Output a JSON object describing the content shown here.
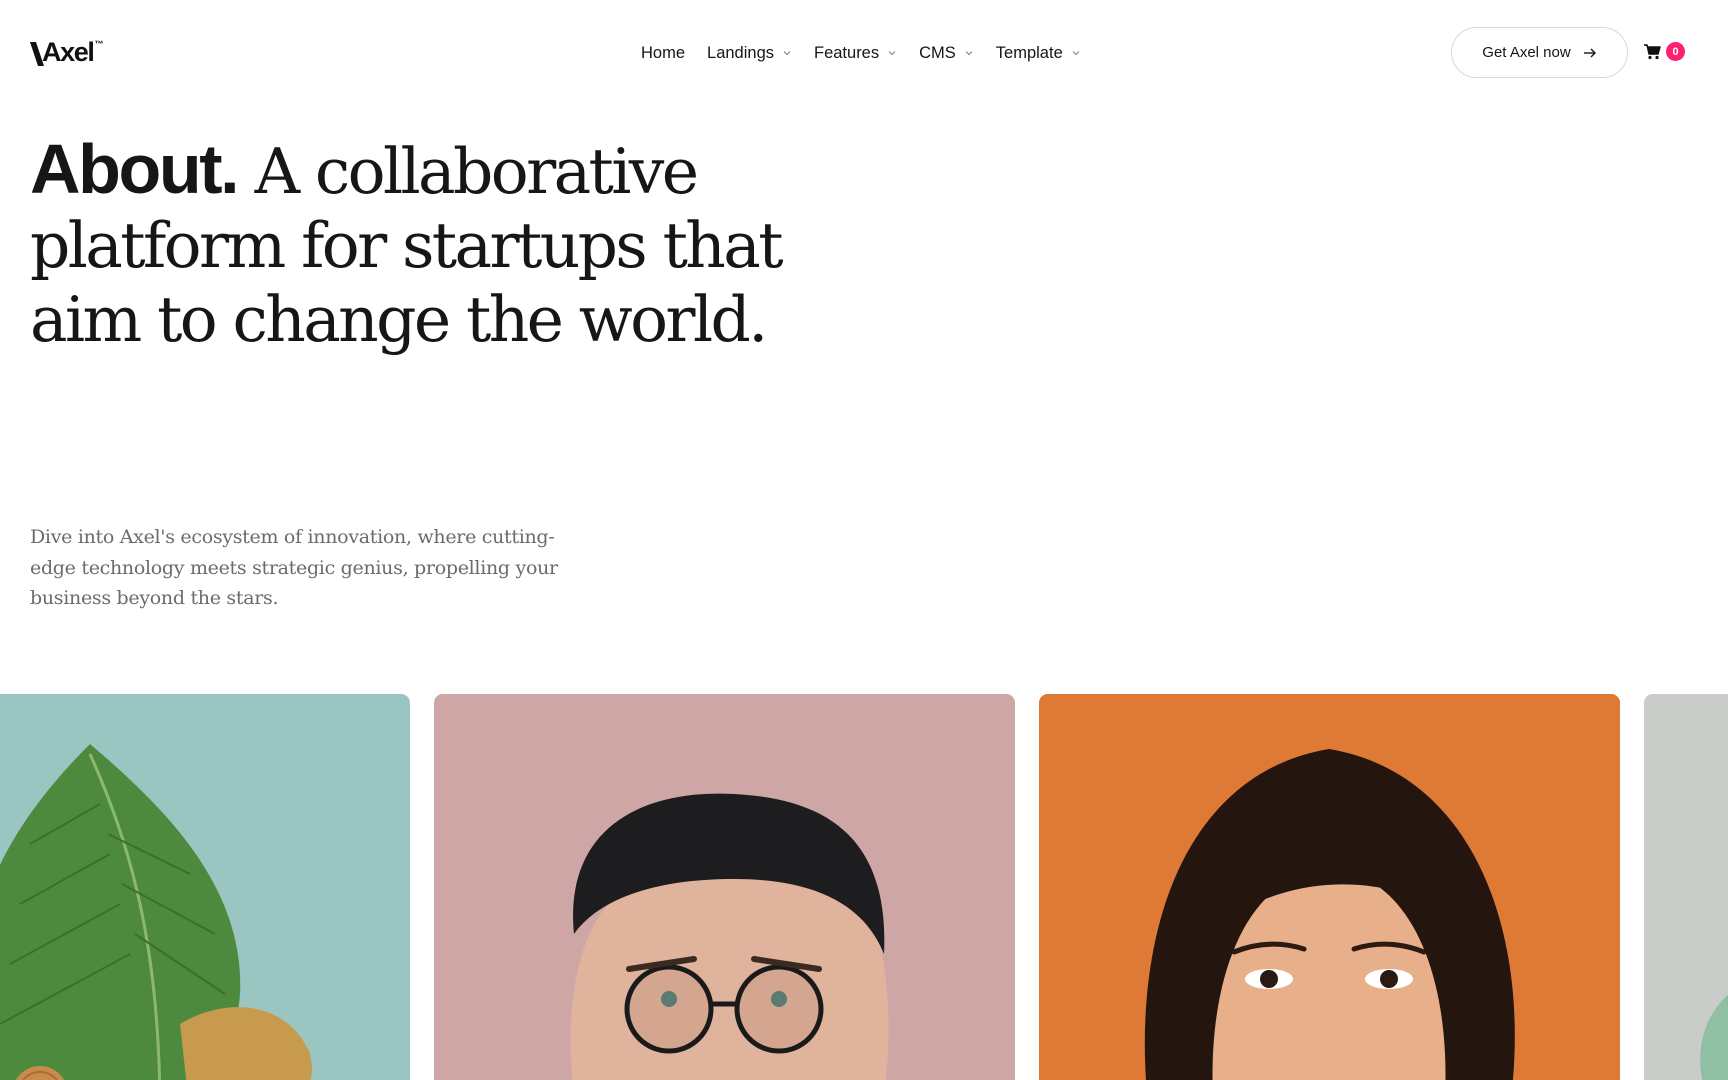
{
  "header": {
    "logo_text": "Axel",
    "logo_tm": "™",
    "nav": [
      {
        "label": "Home",
        "has_dropdown": false
      },
      {
        "label": "Landings",
        "has_dropdown": true
      },
      {
        "label": "Features",
        "has_dropdown": true
      },
      {
        "label": "CMS",
        "has_dropdown": true
      },
      {
        "label": "Template",
        "has_dropdown": true
      }
    ],
    "cta_label": "Get Axel now",
    "cart_count": "0"
  },
  "hero": {
    "title_strong": "About.",
    "title_rest": " A collaborative platform for startups that aim to change the world.",
    "description": "Dive into Axel's ecosystem of innovation, where cutting-edge technology meets strategic genius, propelling your business beyond the stars."
  },
  "gallery": [
    {
      "subject": "leaves-with-coin",
      "bg": "#9ac5c1"
    },
    {
      "subject": "man-with-glasses-and-cap",
      "bg": "#cfa6a6"
    },
    {
      "subject": "woman-portrait",
      "bg": "#de7a36"
    },
    {
      "subject": "partial-image",
      "bg": "#c9ccc8"
    }
  ],
  "colors": {
    "text": "#161616",
    "muted": "#6b6b6b",
    "badge": "#ff1f73"
  }
}
